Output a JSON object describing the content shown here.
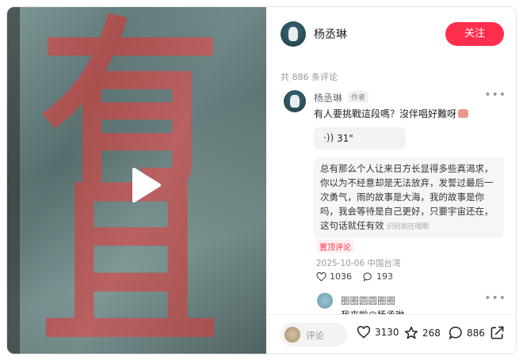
{
  "video": {
    "overlay_text_top": "有",
    "overlay_text_bottom": "且"
  },
  "header": {
    "author_name": "杨丞琳",
    "follow_label": "关注"
  },
  "comments_count_label": "共 886 条评论",
  "comment": {
    "author": "杨丞琳",
    "author_badge": "作者",
    "text": "有人要挑戰這段嗎？沒伴唱好難呀",
    "voice_duration": "31\"",
    "lyric_text": "总有那么个人让来日方长显得多些真渴求，你以为不经意却是无法放弃，发誓过最后一次勇气，雨的故事是大海，我的故事是你吗，我会等待是自己更好，只要宇宙还在，这句话就任有效",
    "lyric_source": "识别到在唱歌",
    "pinned_label": "置顶评论",
    "date_location": "2025-10-06 中国台湾",
    "likes": "1036",
    "replies": "193"
  },
  "reply": {
    "author": "圈圈圆圆圈圈",
    "text": "我来啦@杨丞琳"
  },
  "bottom_bar": {
    "comment_placeholder": "评论",
    "like_count": "3130",
    "star_count": "268",
    "comment_count": "886"
  },
  "colors": {
    "accent": "#ff2e4d",
    "video_bg": "#647c7c",
    "video_text": "#b25453"
  }
}
